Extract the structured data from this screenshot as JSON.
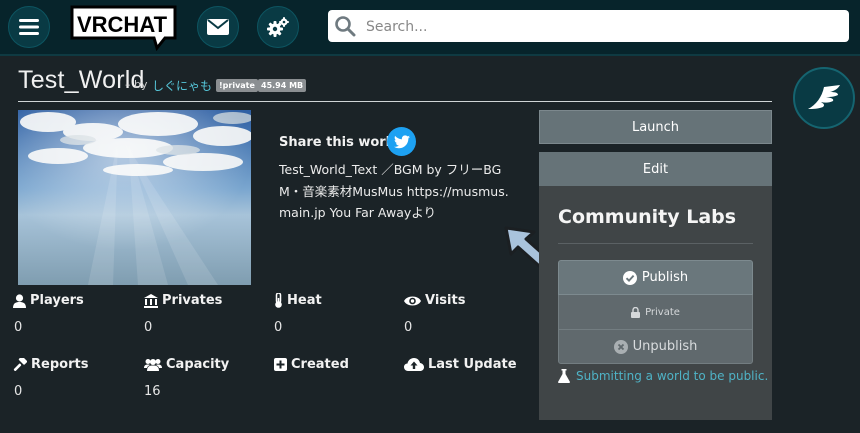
{
  "topbar": {
    "logo_text": "VRCHAT",
    "search_placeholder": "Search..."
  },
  "world": {
    "title": "Test_World",
    "by_label": "– by",
    "author": "しぐにゃも",
    "badges": [
      "!private",
      "45.94 MB"
    ]
  },
  "share": {
    "label": "Share this world"
  },
  "description": "Test_World_Text ／BGM by フリーBGM・音楽素材MusMus https://musmus.main.jp You Far Awayより",
  "stats": [
    {
      "label": "Players",
      "value": "0",
      "icon": "user-icon"
    },
    {
      "label": "Privates",
      "value": "0",
      "icon": "privates-icon"
    },
    {
      "label": "Heat",
      "value": "0",
      "icon": "thermometer-icon"
    },
    {
      "label": "Visits",
      "value": "0",
      "icon": "eye-icon"
    },
    {
      "label": "Reports",
      "value": "0",
      "icon": "hammer-icon"
    },
    {
      "label": "Capacity",
      "value": "16",
      "icon": "users-icon"
    },
    {
      "label": "Created",
      "value": "",
      "icon": "plus-square-icon"
    },
    {
      "label": "Last Update",
      "value": "",
      "icon": "cloud-upload-icon"
    }
  ],
  "actions": {
    "launch": "Launch",
    "edit": "Edit"
  },
  "labs": {
    "title": "Community Labs",
    "publish": "Publish",
    "private": "Private",
    "unpublish": "Unpublish",
    "submit_link": "Submitting a world to be public."
  },
  "colors": {
    "topbar": "#07242b",
    "background": "#1b2327",
    "accent": "#55c5d8",
    "twitter": "#1da1f2"
  }
}
